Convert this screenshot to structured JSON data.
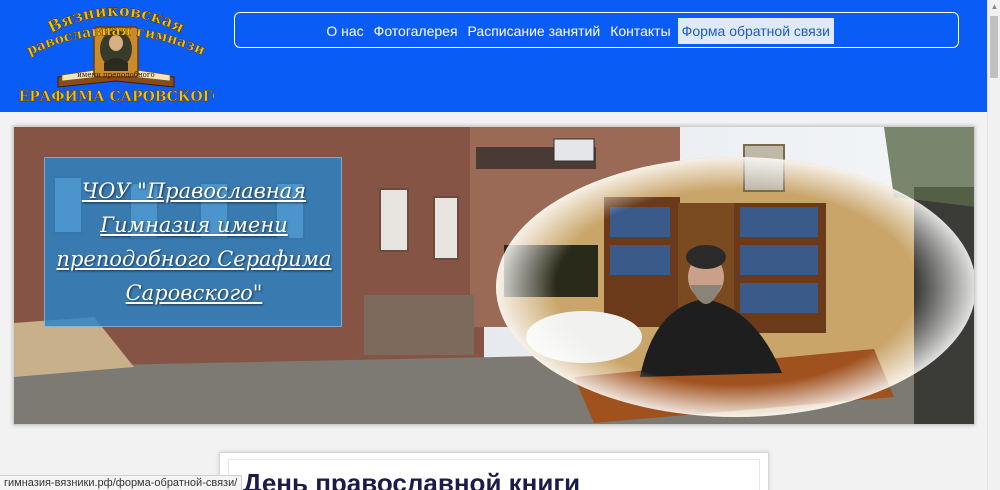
{
  "header": {
    "logo": {
      "line1": "Вязниковская",
      "line2": "православная гимназия",
      "line3": "имени преподобного",
      "line4": "СЕРАФИМА САРОВСКОГО"
    },
    "nav": [
      {
        "label": "О нас"
      },
      {
        "label": "Фотогалерея"
      },
      {
        "label": "Расписание занятий"
      },
      {
        "label": "Контакты"
      },
      {
        "label": "Форма обратной связи"
      }
    ]
  },
  "banner": {
    "title": "ЧОУ \"Православная Гимназия имени преподобного Серафима Саровского\""
  },
  "article": {
    "title": "День православной книги"
  },
  "status_bar": {
    "url": "гимназия-вязники.рф/форма-обратной-связи/"
  },
  "colors": {
    "header_bg": "#0a5cf7",
    "nav_active_bg": "#dfe9f7",
    "nav_active_text": "#1a5cc8",
    "logo_text": "#f2c200"
  }
}
